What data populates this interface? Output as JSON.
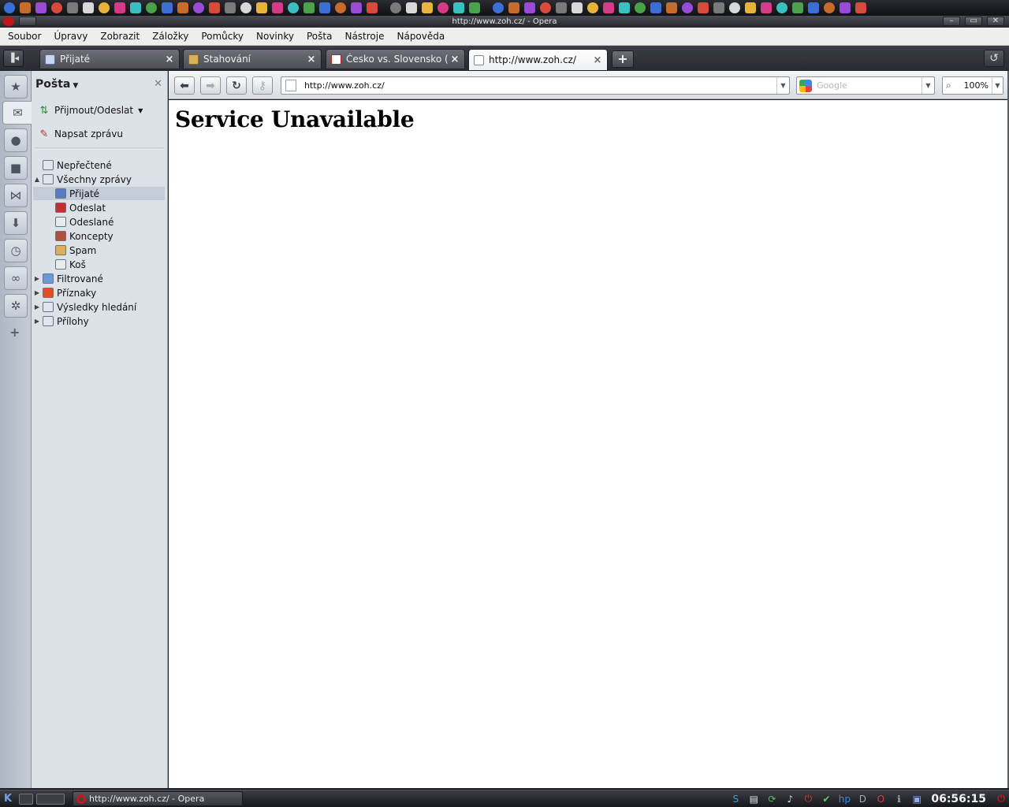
{
  "window": {
    "title": "http://www.zoh.cz/ - Opera"
  },
  "launcher": {
    "icons": [
      "thunderbird-icon",
      "bird-icon",
      "eye-icon",
      "eye2-icon",
      "swirl-icon",
      "kmail-icon",
      "ticket-icon",
      "b-icon",
      "game-icon",
      "drive-icon",
      "globe-icon",
      "vlc-icon",
      "dvd-icon",
      "tools-icon",
      "gears-icon",
      "flower-icon",
      "star-icon",
      "film-icon",
      "red-car-icon",
      "box-icon",
      "tree-icon",
      "blue-square-icon",
      "spinner-icon",
      "green-globe-icon",
      "table-icon",
      "terminal-icon",
      "calc-icon",
      "window-icon",
      "pen-icon",
      "kde-icon",
      "bird2-icon",
      "web-icon",
      "disk-icon",
      "firefox-icon",
      "leaf-icon",
      "opera-icon",
      "network-icon",
      "file-icon",
      "gear-icon",
      "icq-icon",
      "globe2-icon",
      "skype-icon",
      "doc-icon",
      "sheet-icon",
      "chart-icon",
      "present-icon",
      "draw-icon",
      "graph-icon",
      "app-icon",
      "d-icon",
      "uranus-icon",
      "ball-icon",
      "check-icon",
      "cross-icon"
    ]
  },
  "menubar": {
    "items": [
      "Soubor",
      "Úpravy",
      "Zobrazit",
      "Záložky",
      "Pomůcky",
      "Novinky",
      "Pošta",
      "Nástroje",
      "Nápověda"
    ]
  },
  "tabs": [
    {
      "label": "Přijaté",
      "icon": "inbox-icon",
      "active": false
    },
    {
      "label": "Stahování",
      "icon": "download-icon",
      "active": false
    },
    {
      "label": "Česko vs. Slovensko (...",
      "icon": "info-icon",
      "active": false
    },
    {
      "label": "http://www.zoh.cz/",
      "icon": "page-icon",
      "active": true
    }
  ],
  "tab_close_glyph": "×",
  "strip": {
    "buttons": [
      "bookmarks-icon",
      "mail-icon",
      "contacts-icon",
      "notes-icon",
      "transfers-icon",
      "downloads-icon",
      "history-icon",
      "links-icon",
      "settings-icon",
      "add-panel-icon"
    ]
  },
  "mail_panel": {
    "title": "Pošta",
    "receive_send": "Přijmout/Odeslat",
    "compose": "Napsat zprávu",
    "folders": [
      {
        "label": "Nepřečtené",
        "icon": "unread-icon",
        "level": 0,
        "expander": ""
      },
      {
        "label": "Všechny zprávy",
        "icon": "all-mail-icon",
        "level": 0,
        "expander": "▲"
      },
      {
        "label": "Přijaté",
        "icon": "inbox-icon",
        "level": 1,
        "expander": "",
        "selected": true
      },
      {
        "label": "Odeslat",
        "icon": "outbox-icon",
        "level": 1,
        "expander": ""
      },
      {
        "label": "Odeslané",
        "icon": "sent-icon",
        "level": 1,
        "expander": ""
      },
      {
        "label": "Koncepty",
        "icon": "drafts-icon",
        "level": 1,
        "expander": ""
      },
      {
        "label": "Spam",
        "icon": "spam-icon",
        "level": 1,
        "expander": ""
      },
      {
        "label": "Koš",
        "icon": "trash-icon",
        "level": 1,
        "expander": ""
      },
      {
        "label": "Filtrované",
        "icon": "filter-icon",
        "level": 0,
        "expander": "▶"
      },
      {
        "label": "Příznaky",
        "icon": "flag-icon",
        "level": 0,
        "expander": "▶"
      },
      {
        "label": "Výsledky hledání",
        "icon": "search-icon",
        "level": 0,
        "expander": "▶"
      },
      {
        "label": "Přílohy",
        "icon": "attachment-icon",
        "level": 0,
        "expander": "▶"
      }
    ]
  },
  "navbar": {
    "address": "http://www.zoh.cz/",
    "search_placeholder": "Google",
    "zoom": "100%"
  },
  "content": {
    "heading": "Service Unavailable"
  },
  "taskbar": {
    "task_label": "http://www.zoh.cz/ - Opera",
    "clock": "06:56:15",
    "tray_icons": [
      "skype-icon",
      "clipboard-icon",
      "update-icon",
      "volume-icon",
      "power-icon",
      "check-icon",
      "hp-icon",
      "d-icon",
      "opera-icon",
      "info-icon",
      "window-icon",
      "shutdown-icon"
    ]
  }
}
